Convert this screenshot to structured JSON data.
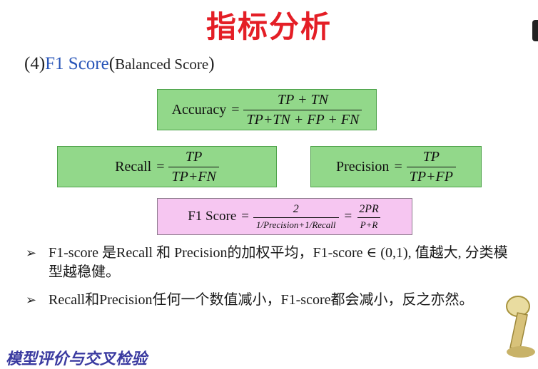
{
  "header": {
    "title": "指标分析"
  },
  "subtitle": {
    "index": "(4)",
    "term": "F1 Score",
    "paren_open": "(",
    "note": "Balanced Score",
    "paren_close": ")"
  },
  "formulas": {
    "accuracy": {
      "label": "Accuracy",
      "eq": "=",
      "num": "TP + TN",
      "den": "TP+TN + FP + FN"
    },
    "recall": {
      "label": "Recall",
      "eq": "=",
      "num": "TP",
      "den": "TP+FN"
    },
    "precision": {
      "label": "Precision",
      "eq": "=",
      "num": "TP",
      "den": "TP+FP"
    },
    "f1": {
      "label": "F1 Score",
      "eq": "=",
      "num": "2",
      "den": "1/Precision+1/Recall",
      "eq2": "=",
      "num2": "2PR",
      "den2": "P+R"
    }
  },
  "bullets": [
    "F1-score 是Recall 和 Precision的加权平均，F1-score ∈ (0,1), 值越大, 分类模型越稳健。",
    "Recall和Precision任何一个数值减小，F1-score都会减小，反之亦然。"
  ],
  "footer": {
    "text": "模型评价与交叉检验"
  },
  "colors": {
    "title": "#e41e26",
    "formula_box": "#92d88a",
    "f1_box": "#f6c6f1",
    "term": "#2855b8"
  }
}
